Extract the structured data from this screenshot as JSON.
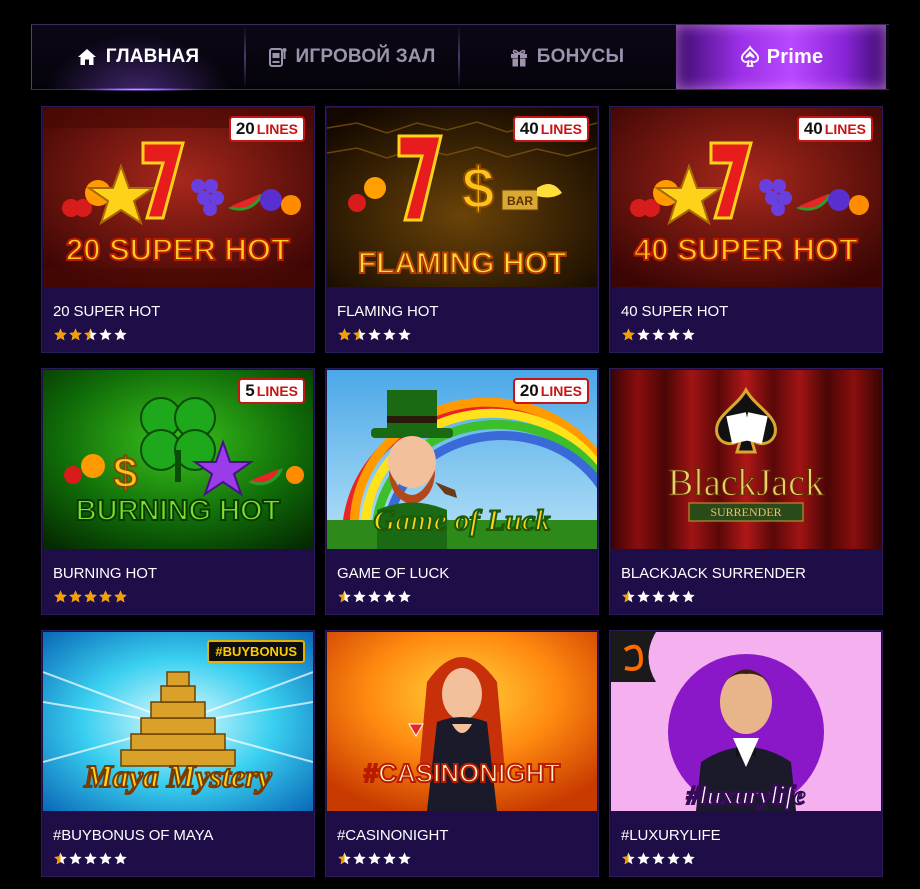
{
  "nav": {
    "home": "ГЛАВНАЯ",
    "hall": "ИГРОВОЙ ЗАЛ",
    "bonus": "БОНУСЫ",
    "prime": "Prime"
  },
  "colors": {
    "card_bg": "#1e0d47",
    "star_active": "#f5a000",
    "star_inactive": "#ffffff",
    "accent": "#9a2fe6"
  },
  "games": [
    {
      "title": "20 SUPER HOT",
      "badge": "20",
      "badge_unit": "LINES",
      "art_text": "20 SUPER HOT",
      "rating": 2.5
    },
    {
      "title": "FLAMING HOT",
      "badge": "40",
      "badge_unit": "LINES",
      "art_text": "FLAMING HOT",
      "rating": 1.5
    },
    {
      "title": "40 SUPER HOT",
      "badge": "40",
      "badge_unit": "LINES",
      "art_text": "40 SUPER HOT",
      "rating": 1
    },
    {
      "title": "BURNING HOT",
      "badge": "5",
      "badge_unit": "LINES",
      "art_text": "BURNING HOT",
      "rating": 5
    },
    {
      "title": "GAME OF LUCK",
      "badge": "20",
      "badge_unit": "LINES",
      "art_text": "Game of Luck",
      "rating": 0.5
    },
    {
      "title": "BLACKJACK SURRENDER",
      "badge": "",
      "badge_unit": "",
      "art_text": "BlackJack",
      "art_sub": "SURRENDER",
      "rating": 0.5
    },
    {
      "title": "#BUYBONUS OF MAYA",
      "badge": "#BUYBONUS",
      "badge_unit": "",
      "art_text": "Maya Mystery",
      "rating": 0.5
    },
    {
      "title": "#CASINONIGHT",
      "badge": "",
      "badge_unit": "",
      "art_text": "#CASINONIGHT",
      "rating": 0.5
    },
    {
      "title": "#LUXURYLIFE",
      "badge": "",
      "badge_unit": "",
      "art_text": "#luxurylife",
      "rating": 0.5
    }
  ]
}
